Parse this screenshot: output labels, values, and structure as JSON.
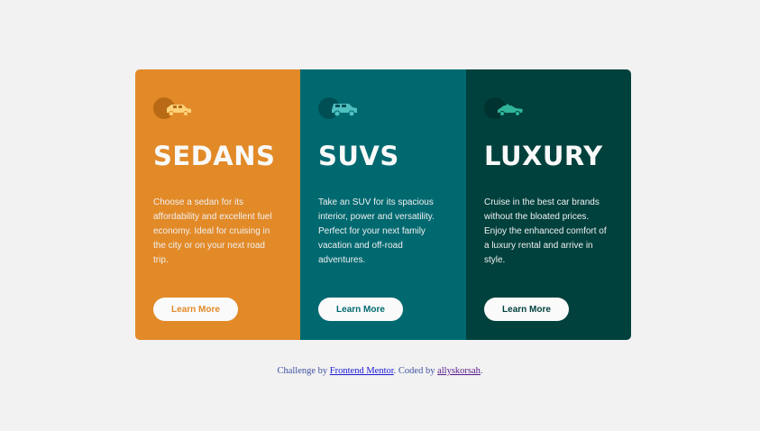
{
  "cards": [
    {
      "id": "sedans",
      "title": "SEDANS",
      "description": "Choose a sedan for its affordability and excellent fuel economy. Ideal for cruising in the city or on your next road trip.",
      "button_label": "Learn More",
      "icon": "sedan-car-icon",
      "accent": "#e28a28"
    },
    {
      "id": "suvs",
      "title": "SUVS",
      "description": "Take an SUV for its spacious interior, power and versatility. Perfect for your next family vacation and off-road adventures.",
      "button_label": "Learn More",
      "icon": "suv-car-icon",
      "accent": "#006970"
    },
    {
      "id": "luxury",
      "title": "LUXURY",
      "description": "Cruise in the best car brands without the bloated prices. Enjoy the enhanced comfort of a luxury rental and arrive in style.",
      "button_label": "Learn More",
      "icon": "luxury-car-icon",
      "accent": "#00413d"
    }
  ],
  "attribution": {
    "prefix": "Challenge by ",
    "link1": "Frontend Mentor",
    "middle": ". Coded by ",
    "link2": "allyskorsah",
    "suffix": "."
  },
  "colors": {
    "background": "#f2f2f2",
    "sedans": "#e28a28",
    "suvs": "#006970",
    "luxury": "#00413d",
    "sedan_icon": "#ffd27a",
    "suv_icon": "#4fc0c0",
    "luxury_icon": "#2fb59a"
  }
}
